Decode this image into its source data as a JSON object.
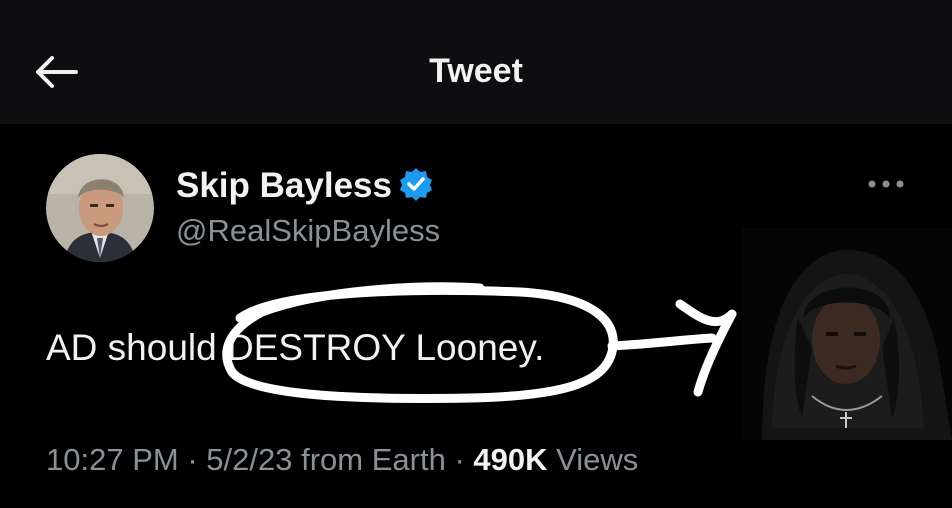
{
  "header": {
    "back_icon": "arrow-left-icon",
    "title": "Tweet"
  },
  "tweet": {
    "author": {
      "display_name": "Skip Bayless",
      "handle": "@RealSkipBayless",
      "verified_icon": "verified-badge-icon",
      "verified_color": "#1d9bf0"
    },
    "more_icon": "more-dots-icon",
    "text": "AD should DESTROY Looney.",
    "meta": {
      "time": "10:27 PM",
      "separator": "·",
      "date": "5/2/23",
      "source": "from Earth",
      "views_count": "490K",
      "views_label": "Views"
    }
  },
  "annotations": {
    "circle_color": "#ffffff",
    "arrow_color": "#ffffff"
  }
}
